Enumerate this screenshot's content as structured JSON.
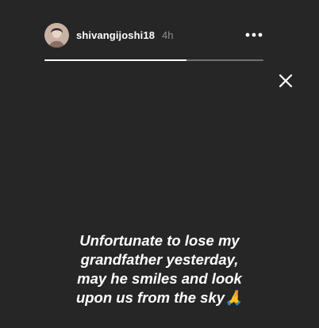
{
  "story": {
    "username": "shivangijoshi18",
    "time": "4h",
    "progress_fraction": 0.65,
    "caption_lines": [
      "Unfortunate to lose my",
      "grandfather yesterday,",
      "may he smiles and look",
      "upon us from the sky🙏"
    ]
  },
  "icons": {
    "avatar": "profile-photo",
    "more": "more-horizontal-icon",
    "close": "close-icon"
  },
  "colors": {
    "background": "#262626",
    "text": "#ffffff",
    "muted": "#8e8e8e"
  }
}
